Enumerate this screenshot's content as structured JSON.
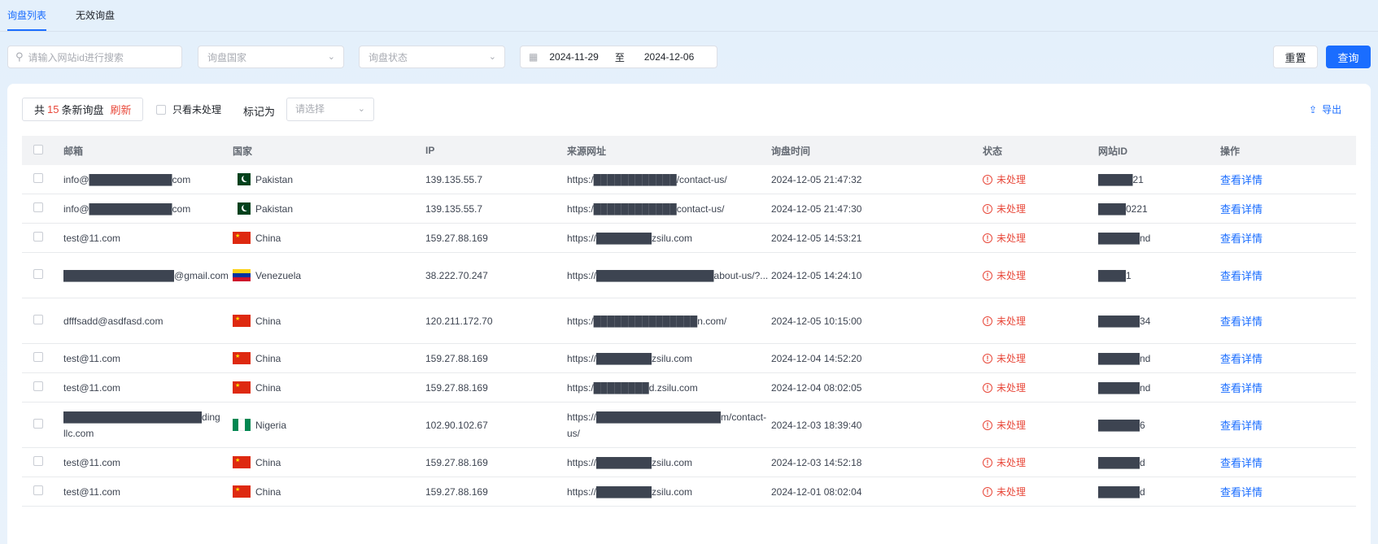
{
  "tabs": [
    "询盘列表",
    "无效询盘"
  ],
  "filters": {
    "search_placeholder": "请输入网站id进行搜索",
    "country_placeholder": "询盘国家",
    "status_placeholder": "询盘状态",
    "date_start": "2024-11-29",
    "date_sep": "至",
    "date_end": "2024-12-06"
  },
  "buttons": {
    "reset": "重置",
    "query": "查询"
  },
  "toolbar": {
    "summary_prefix": "共",
    "summary_count": "15",
    "summary_suffix": "条新询盘",
    "refresh": "刷新",
    "only_unprocessed": "只看未处理",
    "mark_as": "标记为",
    "mark_placeholder": "请选择",
    "export": "导出"
  },
  "columns": [
    "邮箱",
    "国家",
    "IP",
    "来源网址",
    "询盘时间",
    "状态",
    "网站ID",
    "操作"
  ],
  "accent_color": "#1a6dff",
  "status_color": "#e8483a",
  "rows": [
    {
      "email": "info@████████████com",
      "flag": "pk",
      "country": "Pakistan",
      "ip": "139.135.55.7",
      "url": "https:/████████████/contact-us/",
      "time": "2024-12-05 21:47:32",
      "status": "未处理",
      "site_id": "█████21",
      "action": "查看详情"
    },
    {
      "email": "info@████████████com",
      "flag": "pk",
      "country": "Pakistan",
      "ip": "139.135.55.7",
      "url": "https:/████████████contact-us/",
      "time": "2024-12-05 21:47:30",
      "status": "未处理",
      "site_id": "████0221",
      "action": "查看详情"
    },
    {
      "email": "test@11.com",
      "flag": "cn",
      "country": "China",
      "ip": "159.27.88.169",
      "url": "https://████████zsilu.com",
      "time": "2024-12-05 14:53:21",
      "status": "未处理",
      "site_id": "██████nd",
      "action": "查看详情"
    },
    {
      "email": "████████████████@gmail.com",
      "flag": "ve",
      "country": "Venezuela",
      "ip": "38.222.70.247",
      "url": "https://█████████████████about-us/?...",
      "time": "2024-12-05 14:24:10",
      "status": "未处理",
      "site_id": "████1",
      "action": "查看详情"
    },
    {
      "email": "dfffsadd@asdfasd.com",
      "flag": "cn",
      "country": "China",
      "ip": "120.211.172.70",
      "url": "https:/███████████████n.com/",
      "time": "2024-12-05 10:15:00",
      "status": "未处理",
      "site_id": "██████34",
      "action": "查看详情"
    },
    {
      "email": "test@11.com",
      "flag": "cn",
      "country": "China",
      "ip": "159.27.88.169",
      "url": "https://████████zsilu.com",
      "time": "2024-12-04 14:52:20",
      "status": "未处理",
      "site_id": "██████nd",
      "action": "查看详情"
    },
    {
      "email": "test@11.com",
      "flag": "cn",
      "country": "China",
      "ip": "159.27.88.169",
      "url": "https:/████████d.zsilu.com",
      "time": "2024-12-04 08:02:05",
      "status": "未处理",
      "site_id": "██████nd",
      "action": "查看详情"
    },
    {
      "email": "████████████████████ding llc.com",
      "flag": "ng",
      "country": "Nigeria",
      "ip": "102.90.102.67",
      "url": "https://██████████████████m/contact-us/",
      "time": "2024-12-03 18:39:40",
      "status": "未处理",
      "site_id": "██████6",
      "action": "查看详情"
    },
    {
      "email": "test@11.com",
      "flag": "cn",
      "country": "China",
      "ip": "159.27.88.169",
      "url": "https://████████zsilu.com",
      "time": "2024-12-03 14:52:18",
      "status": "未处理",
      "site_id": "██████d",
      "action": "查看详情"
    },
    {
      "email": "test@11.com",
      "flag": "cn",
      "country": "China",
      "ip": "159.27.88.169",
      "url": "https://████████zsilu.com",
      "time": "2024-12-01 08:02:04",
      "status": "未处理",
      "site_id": "██████d",
      "action": "查看详情"
    }
  ]
}
